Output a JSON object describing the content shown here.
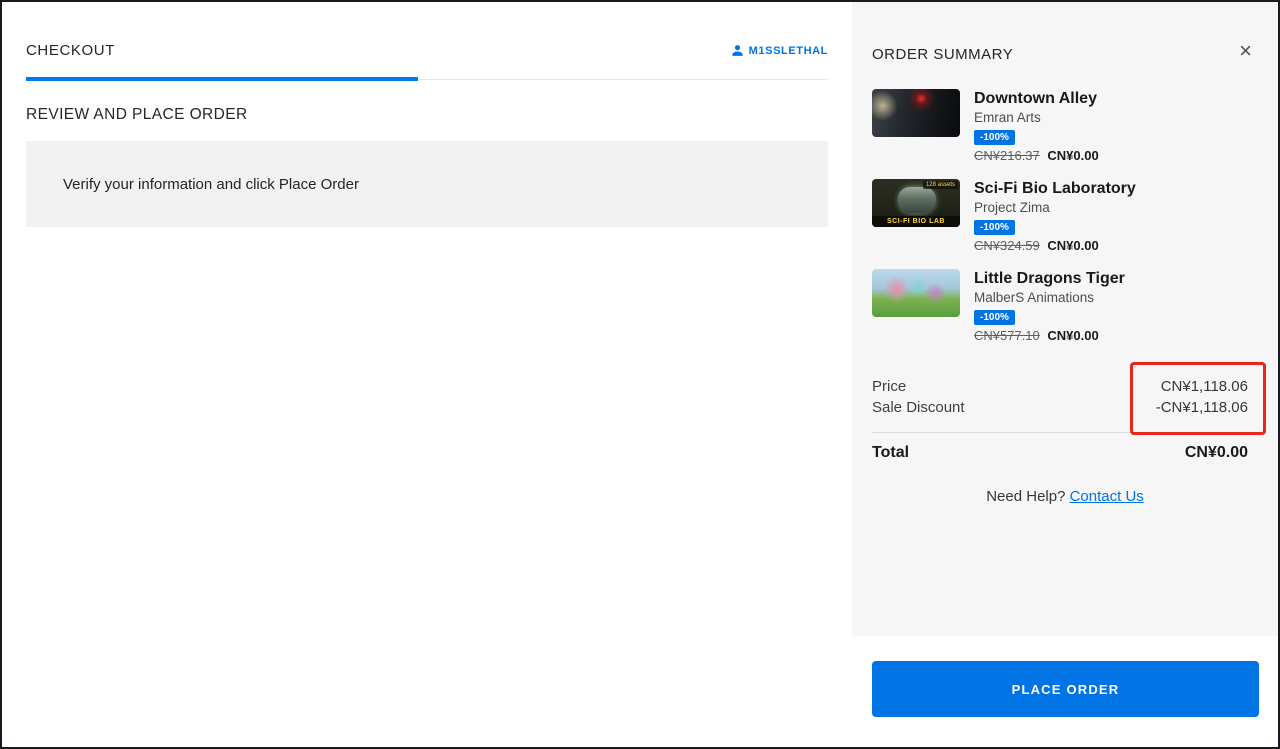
{
  "checkout": {
    "tab_label": "CHECKOUT",
    "user": "M1SSLETHAL",
    "section_title": "REVIEW AND PLACE ORDER",
    "info_message": "Verify your information and click Place Order"
  },
  "order_summary": {
    "title": "ORDER SUMMARY",
    "items": [
      {
        "title": "Downtown Alley",
        "author": "Emran Arts",
        "discount_badge": "-100%",
        "original_price": "CN¥216.37",
        "final_price": "CN¥0.00"
      },
      {
        "title": "Sci-Fi Bio Laboratory",
        "author": "Project Zima",
        "discount_badge": "-100%",
        "original_price": "CN¥324.59",
        "final_price": "CN¥0.00",
        "thumbnail_badge": "128 assets",
        "thumbnail_label": "SCI-FI BIO LAB"
      },
      {
        "title": "Little Dragons Tiger",
        "author": "MalberS Animations",
        "discount_badge": "-100%",
        "original_price": "CN¥577.10",
        "final_price": "CN¥0.00"
      }
    ],
    "price_label": "Price",
    "price_value": "CN¥1,118.06",
    "discount_label": "Sale Discount",
    "discount_value": "-CN¥1,118.06",
    "total_label": "Total",
    "total_value": "CN¥0.00",
    "help_text": "Need Help?",
    "help_link_label": "Contact Us",
    "place_order_label": "PLACE ORDER"
  },
  "icons": {
    "close": "×"
  },
  "colors": {
    "accent_blue": "#0074e4",
    "active_tab_blue": "#0078f2",
    "highlight_red": "#e8261b",
    "panel_gray": "#f6f6f6"
  }
}
